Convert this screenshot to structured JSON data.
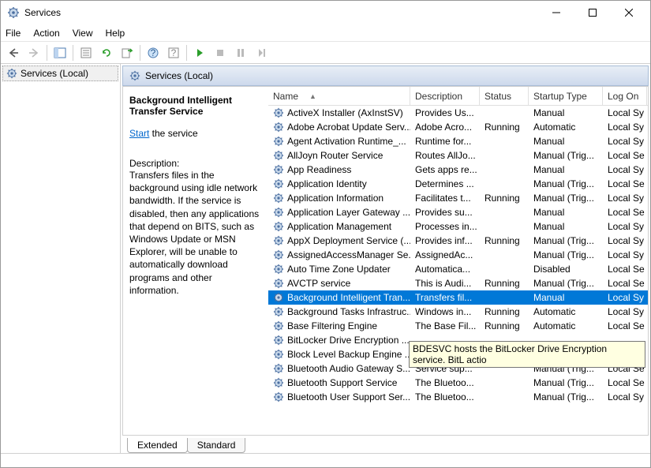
{
  "window": {
    "title": "Services"
  },
  "menu": {
    "file": "File",
    "action": "Action",
    "view": "View",
    "help": "Help"
  },
  "left": {
    "label": "Services (Local)"
  },
  "tabheader": {
    "label": "Services (Local)"
  },
  "detail": {
    "name": "Background Intelligent Transfer Service",
    "start_link": "Start",
    "start_suffix": " the service",
    "desc_label": "Description:",
    "desc": "Transfers files in the background using idle network bandwidth. If the service is disabled, then any applications that depend on BITS, such as Windows Update or MSN Explorer, will be unable to automatically download programs and other information."
  },
  "columns": {
    "name": "Name",
    "desc": "Description",
    "status": "Status",
    "startup": "Startup Type",
    "logon": "Log On"
  },
  "rows": [
    {
      "name": "ActiveX Installer (AxInstSV)",
      "desc": "Provides Us...",
      "status": "",
      "startup": "Manual",
      "logon": "Local Sy"
    },
    {
      "name": "Adobe Acrobat Update Serv...",
      "desc": "Adobe Acro...",
      "status": "Running",
      "startup": "Automatic",
      "logon": "Local Sy"
    },
    {
      "name": "Agent Activation Runtime_...",
      "desc": "Runtime for...",
      "status": "",
      "startup": "Manual",
      "logon": "Local Sy"
    },
    {
      "name": "AllJoyn Router Service",
      "desc": "Routes AllJo...",
      "status": "",
      "startup": "Manual (Trig...",
      "logon": "Local Se"
    },
    {
      "name": "App Readiness",
      "desc": "Gets apps re...",
      "status": "",
      "startup": "Manual",
      "logon": "Local Sy"
    },
    {
      "name": "Application Identity",
      "desc": "Determines ...",
      "status": "",
      "startup": "Manual (Trig...",
      "logon": "Local Se"
    },
    {
      "name": "Application Information",
      "desc": "Facilitates t...",
      "status": "Running",
      "startup": "Manual (Trig...",
      "logon": "Local Sy"
    },
    {
      "name": "Application Layer Gateway ...",
      "desc": "Provides su...",
      "status": "",
      "startup": "Manual",
      "logon": "Local Se"
    },
    {
      "name": "Application Management",
      "desc": "Processes in...",
      "status": "",
      "startup": "Manual",
      "logon": "Local Sy"
    },
    {
      "name": "AppX Deployment Service (...",
      "desc": "Provides inf...",
      "status": "Running",
      "startup": "Manual (Trig...",
      "logon": "Local Sy"
    },
    {
      "name": "AssignedAccessManager Se...",
      "desc": "AssignedAc...",
      "status": "",
      "startup": "Manual (Trig...",
      "logon": "Local Sy"
    },
    {
      "name": "Auto Time Zone Updater",
      "desc": "Automatica...",
      "status": "",
      "startup": "Disabled",
      "logon": "Local Se"
    },
    {
      "name": "AVCTP service",
      "desc": "This is Audi...",
      "status": "Running",
      "startup": "Manual (Trig...",
      "logon": "Local Se"
    },
    {
      "name": "Background Intelligent Tran...",
      "desc": "Transfers fil...",
      "status": "",
      "startup": "Manual",
      "logon": "Local Sy",
      "selected": true
    },
    {
      "name": "Background Tasks Infrastruc...",
      "desc": "Windows in...",
      "status": "Running",
      "startup": "Automatic",
      "logon": "Local Sy"
    },
    {
      "name": "Base Filtering Engine",
      "desc": "The Base Fil...",
      "status": "Running",
      "startup": "Automatic",
      "logon": "Local Se"
    },
    {
      "name": "BitLocker Drive Encryption ...",
      "desc": "",
      "status": "",
      "startup": "",
      "logon": ""
    },
    {
      "name": "Block Level Backup Engine ...",
      "desc": "",
      "status": "",
      "startup": "",
      "logon": ""
    },
    {
      "name": "Bluetooth Audio Gateway S...",
      "desc": "Service sup...",
      "status": "",
      "startup": "Manual (Trig...",
      "logon": "Local Se"
    },
    {
      "name": "Bluetooth Support Service",
      "desc": "The Bluetoo...",
      "status": "",
      "startup": "Manual (Trig...",
      "logon": "Local Se"
    },
    {
      "name": "Bluetooth User Support Ser...",
      "desc": "The Bluetoo...",
      "status": "",
      "startup": "Manual (Trig...",
      "logon": "Local Sy"
    }
  ],
  "tooltip": "BDESVC hosts the BitLocker Drive Encryption service. BitL actio",
  "tabs": {
    "extended": "Extended",
    "standard": "Standard"
  }
}
